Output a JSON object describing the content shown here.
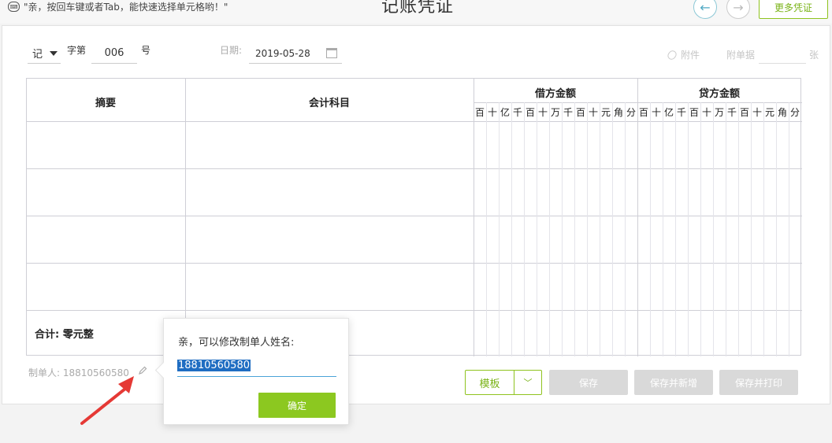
{
  "top": {
    "tip": "\"亲，按回车键或者Tab，能快速选择单元格哟！\"",
    "tip_icon": "keyboard-icon",
    "title": "记账凭证",
    "prev_icon": "arrow-left-icon",
    "next_icon": "arrow-right-icon",
    "more_label": "更多凭证"
  },
  "header": {
    "voucher_type": "记",
    "zi_label": "字第",
    "number": "006",
    "hao_label": "号",
    "date_label": "日期:",
    "date_value": "2019-05-28",
    "attachment_label": "附件",
    "attach_count_label": "附单据",
    "zhang_label": "张"
  },
  "table": {
    "col_summary": "摘要",
    "col_account": "会计科目",
    "col_debit": "借方金额",
    "col_credit": "贷方金额",
    "digits": [
      "百",
      "十",
      "亿",
      "千",
      "百",
      "十",
      "万",
      "千",
      "百",
      "十",
      "元",
      "角",
      "分"
    ],
    "total_label": "合计:",
    "total_value": "零元整"
  },
  "footer": {
    "preparer_label": "制单人:",
    "preparer_value": "18810560580",
    "template_label": "模板",
    "save_label": "保存",
    "save_new_label": "保存并新增",
    "save_print_label": "保存并打印"
  },
  "popover": {
    "label": "亲，可以修改制单人姓名:",
    "input_value": "18810560580",
    "ok_label": "确定"
  },
  "colors": {
    "accent_green": "#8cc820",
    "nav_blue": "#50a9c4",
    "selection_blue": "#1f6dc2",
    "arrow_red": "#e53935"
  }
}
